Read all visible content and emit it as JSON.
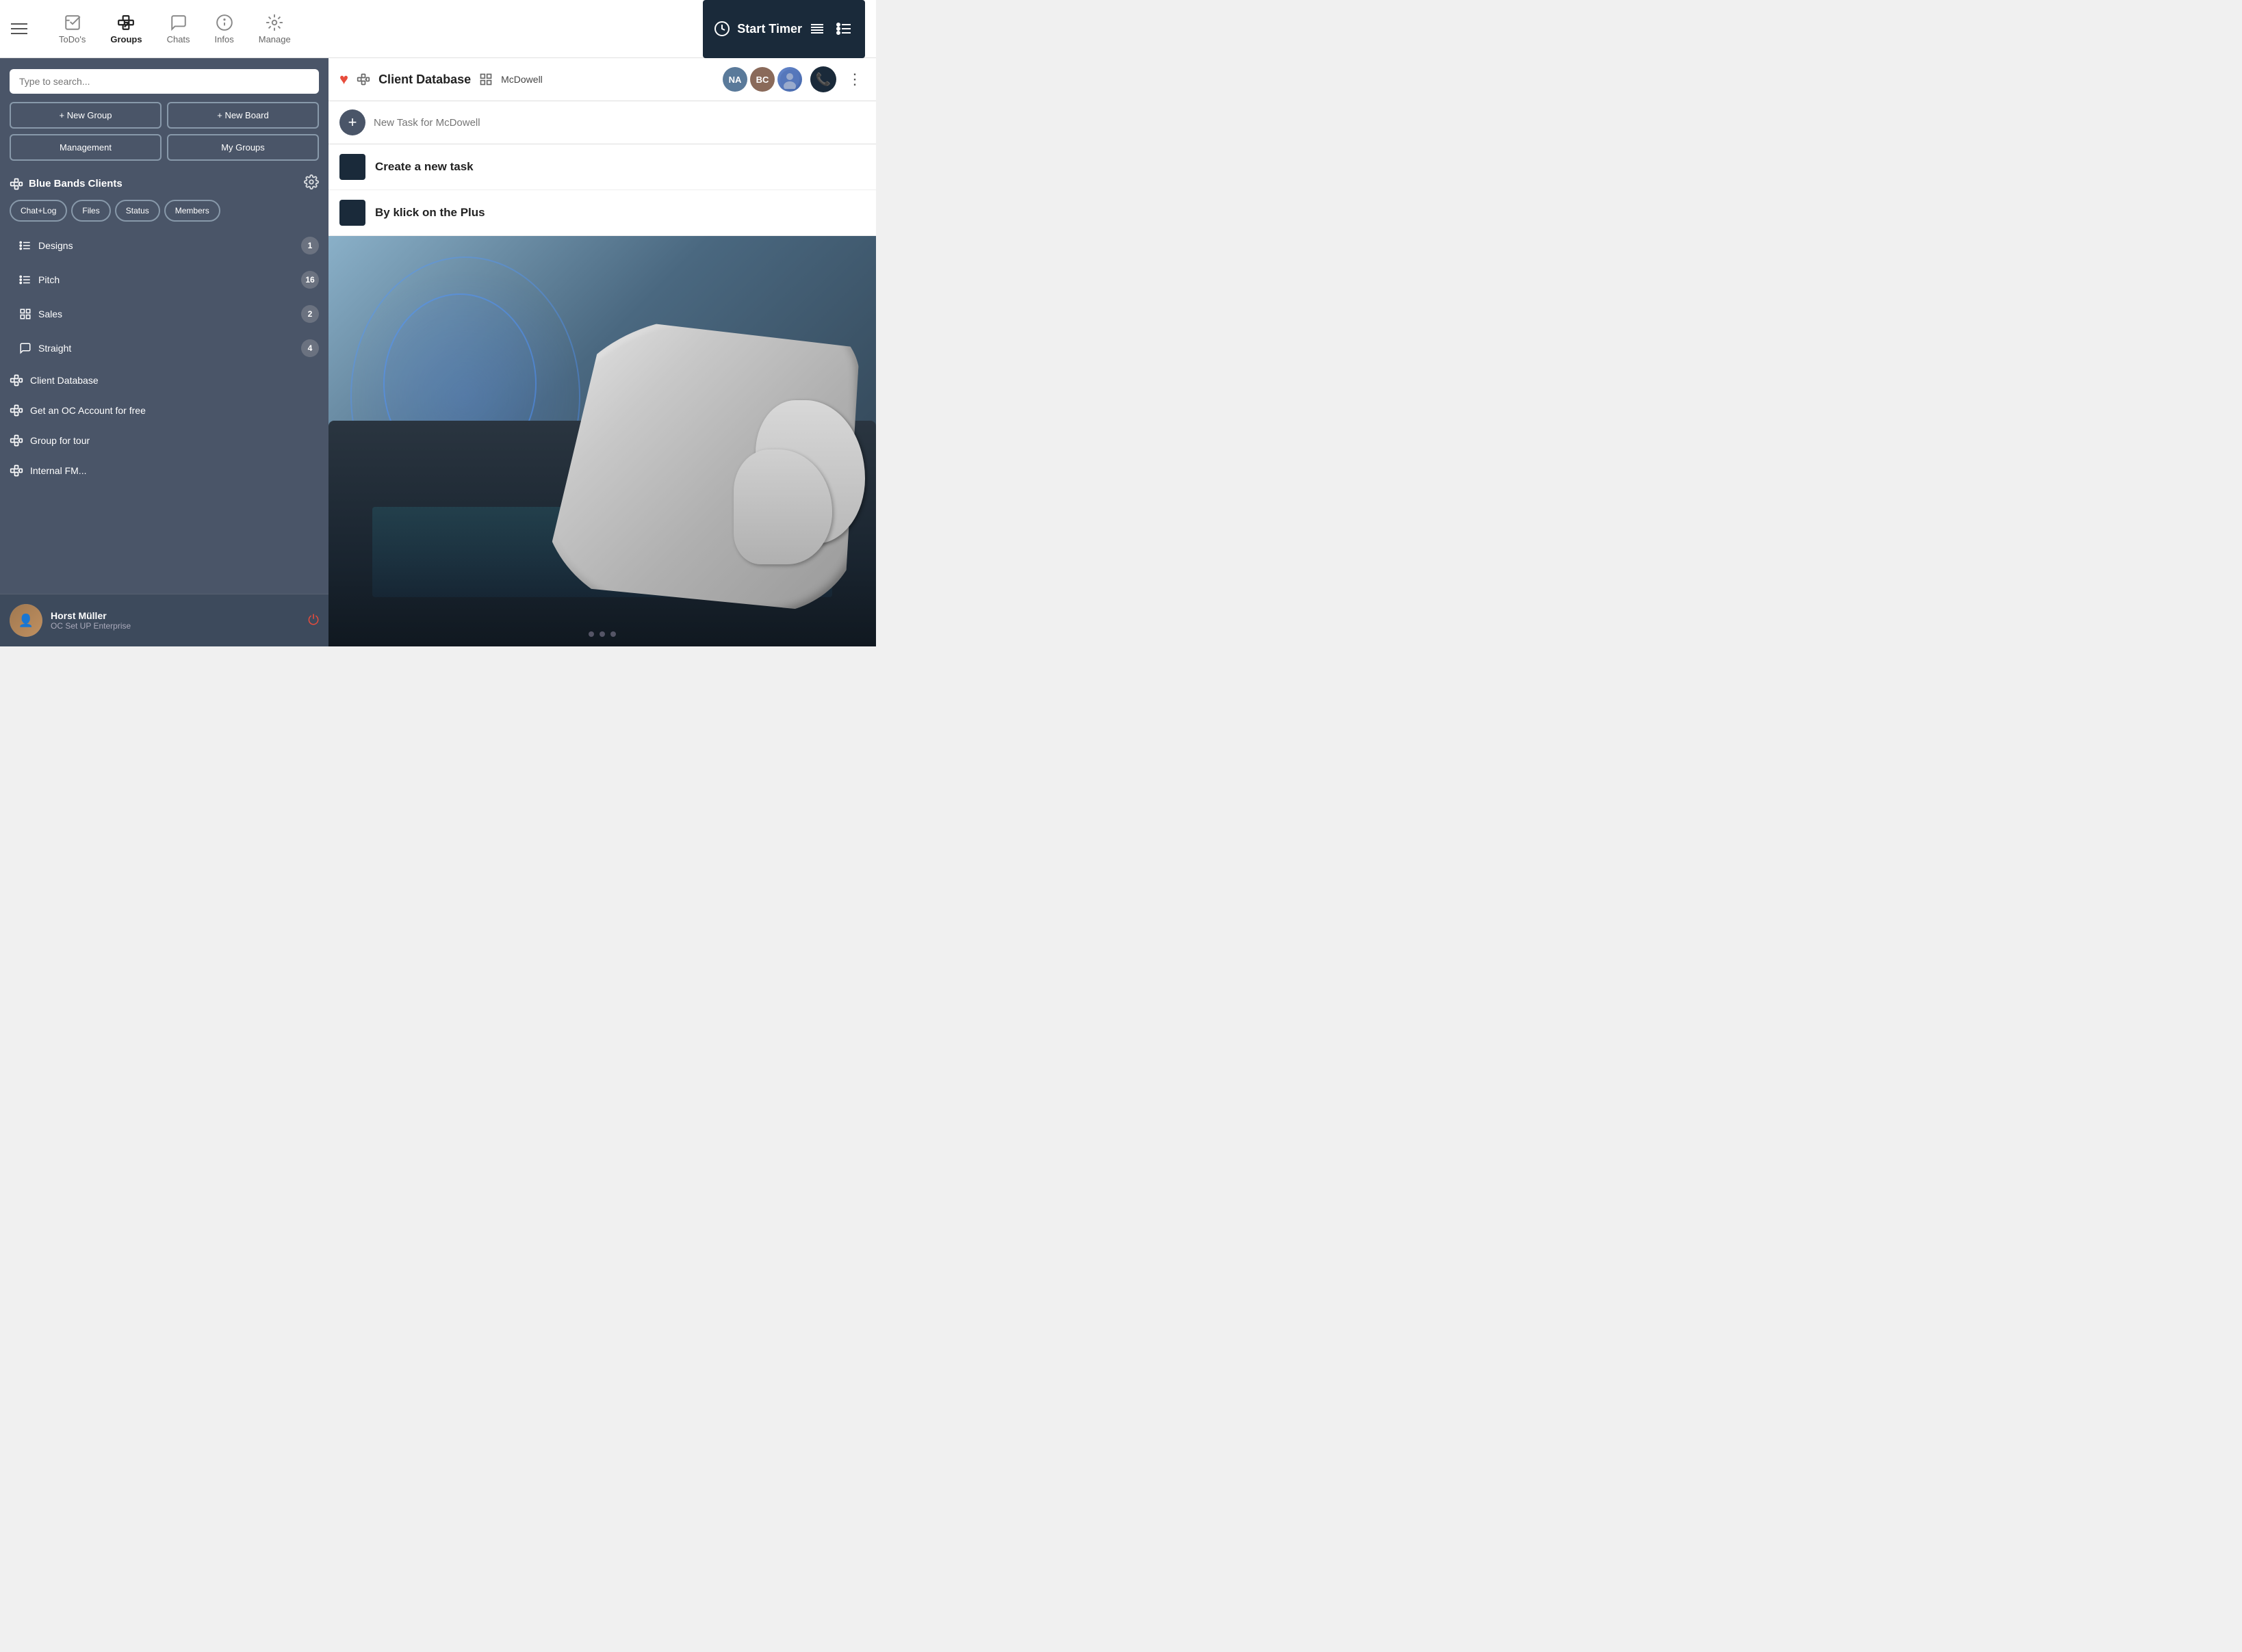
{
  "nav": {
    "hamburger_label": "menu",
    "items": [
      {
        "id": "todos",
        "label": "ToDo's",
        "active": false
      },
      {
        "id": "groups",
        "label": "Groups",
        "active": true
      },
      {
        "id": "chats",
        "label": "Chats",
        "active": false
      },
      {
        "id": "infos",
        "label": "Infos",
        "active": false
      },
      {
        "id": "manage",
        "label": "Manage",
        "active": false
      }
    ],
    "start_timer": "Start Timer"
  },
  "sidebar": {
    "search_placeholder": "Type to search...",
    "buttons": [
      {
        "id": "new-group",
        "label": "+ New Group"
      },
      {
        "id": "new-board",
        "label": "+ New Board"
      },
      {
        "id": "management",
        "label": "Management"
      },
      {
        "id": "my-groups",
        "label": "My Groups"
      }
    ],
    "active_group": {
      "name": "Blue Bands Clients",
      "tabs": [
        "Chat+Log",
        "Files",
        "Status",
        "Members"
      ]
    },
    "list_items": [
      {
        "id": "designs",
        "icon": "list",
        "label": "Designs",
        "count": 1
      },
      {
        "id": "pitch",
        "icon": "list",
        "label": "Pitch",
        "count": 16
      },
      {
        "id": "sales",
        "icon": "grid",
        "label": "Sales",
        "count": 2
      },
      {
        "id": "straight",
        "icon": "chat",
        "label": "Straight",
        "count": 4
      }
    ],
    "groups": [
      {
        "id": "client-database",
        "label": "Client Database"
      },
      {
        "id": "oc-account",
        "label": "Get an OC Account for free"
      },
      {
        "id": "group-tour",
        "label": "Group for tour"
      },
      {
        "id": "internal-fm",
        "label": "Internal FM..."
      }
    ],
    "user": {
      "name": "Horst Müller",
      "subtitle": "OC Set UP Enterprise"
    }
  },
  "main": {
    "header": {
      "group_name": "Client Database",
      "board_name": "McDowell",
      "avatars": [
        {
          "initials": "NA",
          "color": "#5a7a9a"
        },
        {
          "initials": "BC",
          "color": "#8a6a5a"
        }
      ]
    },
    "task_input": {
      "placeholder": "New Task for McDowell"
    },
    "tasks": [
      {
        "id": "task-1",
        "label": "Create a new task"
      },
      {
        "id": "task-2",
        "label": "By klick on the Plus"
      }
    ]
  }
}
